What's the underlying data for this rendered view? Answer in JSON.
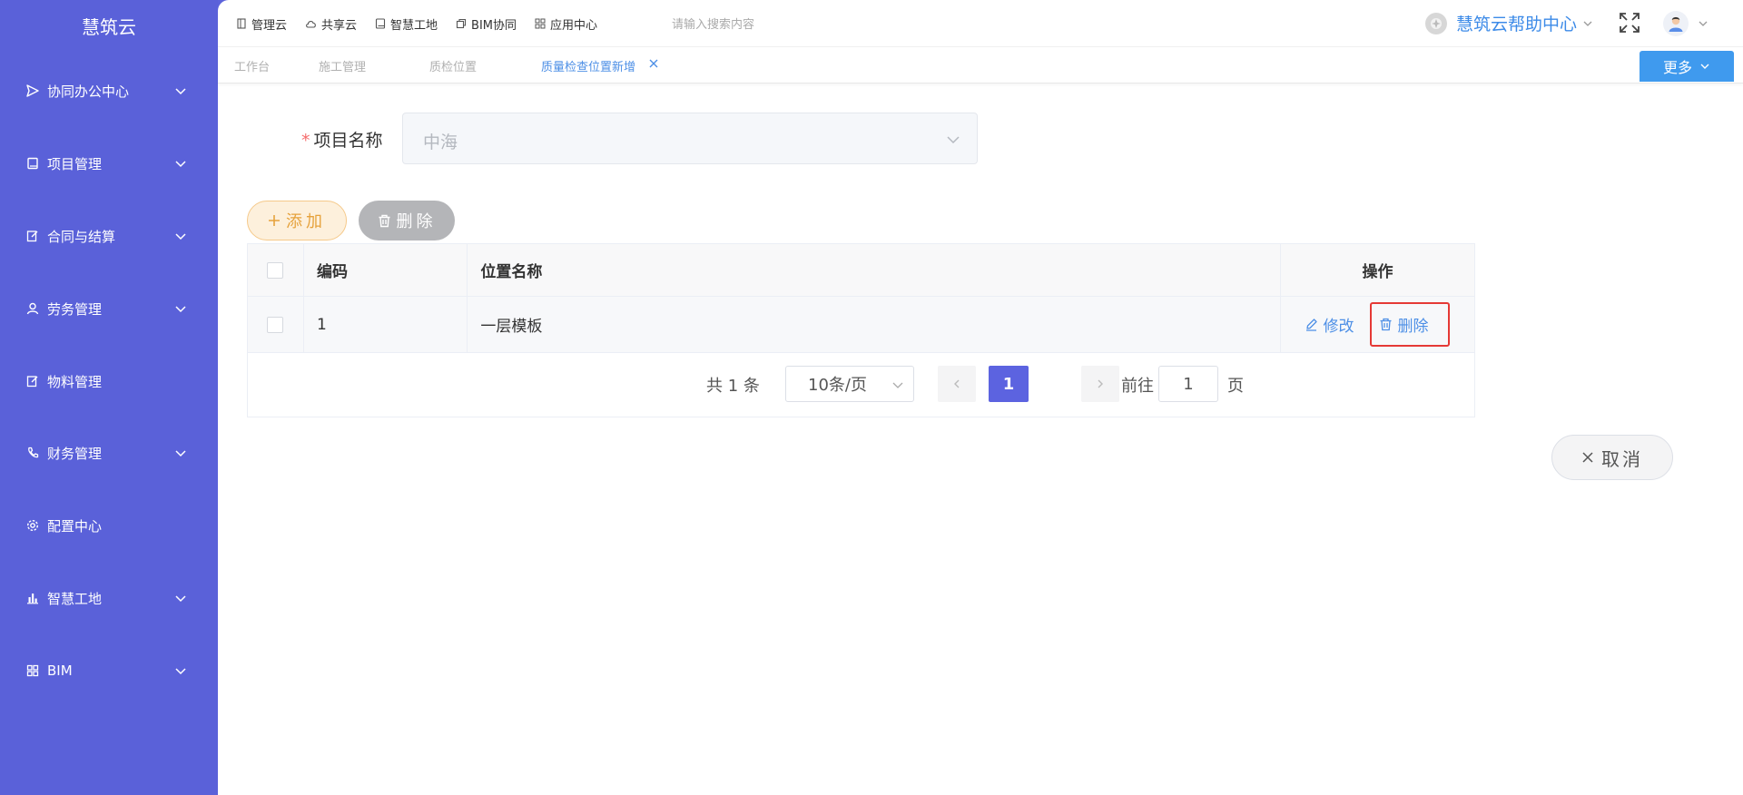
{
  "sidebar": {
    "brand": "慧筑云",
    "items": [
      {
        "label": "协同办公中心",
        "icon": "send-icon",
        "has_children": true
      },
      {
        "label": "项目管理",
        "icon": "book-icon",
        "has_children": true
      },
      {
        "label": "合同与结算",
        "icon": "edit-icon",
        "has_children": true
      },
      {
        "label": "劳务管理",
        "icon": "user-icon",
        "has_children": true
      },
      {
        "label": "物料管理",
        "icon": "edit-icon",
        "has_children": false
      },
      {
        "label": "财务管理",
        "icon": "phone-icon",
        "has_children": true
      },
      {
        "label": "配置中心",
        "icon": "gear-icon",
        "has_children": false
      },
      {
        "label": "智慧工地",
        "icon": "bar-chart-icon",
        "has_children": true
      },
      {
        "label": "BIM",
        "icon": "grid-icon",
        "has_children": true
      }
    ]
  },
  "topnav": {
    "items": [
      {
        "label": "管理云",
        "icon": "document-icon"
      },
      {
        "label": "共享云",
        "icon": "cloud-icon"
      },
      {
        "label": "智慧工地",
        "icon": "book-icon"
      },
      {
        "label": "BIM协同",
        "icon": "layers-icon"
      },
      {
        "label": "应用中心",
        "icon": "grid-icon"
      }
    ],
    "search_placeholder": "请输入搜索内容",
    "help_label": "慧筑云帮助中心"
  },
  "tabs": {
    "items": [
      {
        "label": "工作台",
        "active": false
      },
      {
        "label": "施工管理",
        "active": false
      },
      {
        "label": "质检位置",
        "active": false
      },
      {
        "label": "质量检查位置新增",
        "active": true
      }
    ],
    "more_label": "更多"
  },
  "form": {
    "project_label": "项目名称",
    "required_mark": "*",
    "project_value": "中海"
  },
  "actions": {
    "add_label": "添加",
    "delete_label": "删除"
  },
  "table": {
    "headers": {
      "code": "编码",
      "name": "位置名称",
      "operation": "操作"
    },
    "rows": [
      {
        "code": "1",
        "name": "一层模板",
        "edit_label": "修改",
        "delete_label": "删除"
      }
    ]
  },
  "pagination": {
    "total_text": "共 1 条",
    "page_size": "10条/页",
    "current_page": "1",
    "goto_label": "前往",
    "goto_value": "1",
    "page_suffix": "页"
  },
  "footer": {
    "cancel_label": "取消"
  },
  "colors": {
    "sidebar_bg": "#5a61d9",
    "primary_blue": "#3f9aee",
    "link_blue": "#4d8fe6",
    "page_active": "#5c63e0",
    "add_orange": "#e6a23c",
    "highlight_red": "#e53935"
  }
}
